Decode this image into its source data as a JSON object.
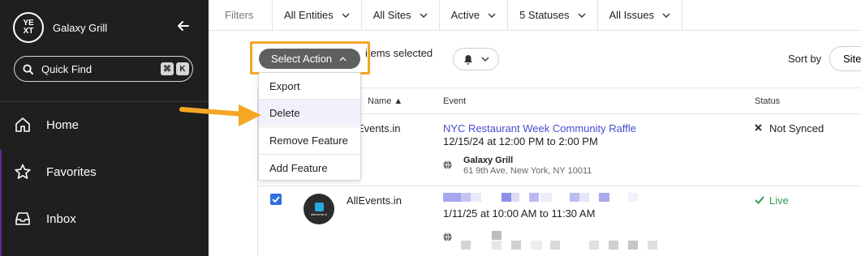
{
  "colors": {
    "sidebar_bg": "#1f1f1f",
    "accent_orange": "#f5a623",
    "link": "#4a4ad0",
    "live_green": "#2e9d4f",
    "checkbox_blue": "#2f6fe0"
  },
  "sidebar": {
    "logo_text": "YEXT",
    "account_name": "Galaxy Grill",
    "collapse_icon": "arrow-left-icon",
    "quick_find": {
      "label": "Quick Find",
      "shortcut_keys": [
        "⌘",
        "K"
      ]
    },
    "nav": [
      {
        "label": "Home",
        "icon": "home-icon"
      },
      {
        "label": "Favorites",
        "icon": "star-icon"
      },
      {
        "label": "Inbox",
        "icon": "inbox-icon"
      }
    ]
  },
  "filters": {
    "label": "Filters",
    "items": [
      "All Entities",
      "All Sites",
      "Active",
      "5 Statuses",
      "All Issues"
    ]
  },
  "toolbar": {
    "select_action_label": "Select Action",
    "items_selected_text": "items selected",
    "sort_label": "Sort by",
    "sort_value": "Site"
  },
  "action_menu": {
    "items": [
      "Export",
      "Delete",
      "Remove Feature",
      "Add Feature"
    ],
    "highlighted": "Delete"
  },
  "table": {
    "headers": {
      "name": "Name",
      "event": "Event",
      "status": "Status"
    },
    "rows": [
      {
        "site": "Events.in",
        "event_title": "NYC Restaurant Week Community Raffle",
        "event_time": "12/15/24 at 12:00 PM to 2:00 PM",
        "location_name": "Galaxy Grill",
        "location_address": "61 9th Ave, New York, NY 10011",
        "status": "Not Synced",
        "status_icon": "x-icon"
      },
      {
        "site": "AllEvents.in",
        "event_time": "1/11/25 at 10:00 AM to 11:30 AM",
        "status": "Live",
        "status_icon": "check-icon",
        "selected": true,
        "avatar_text": "allevents.in"
      }
    ]
  }
}
